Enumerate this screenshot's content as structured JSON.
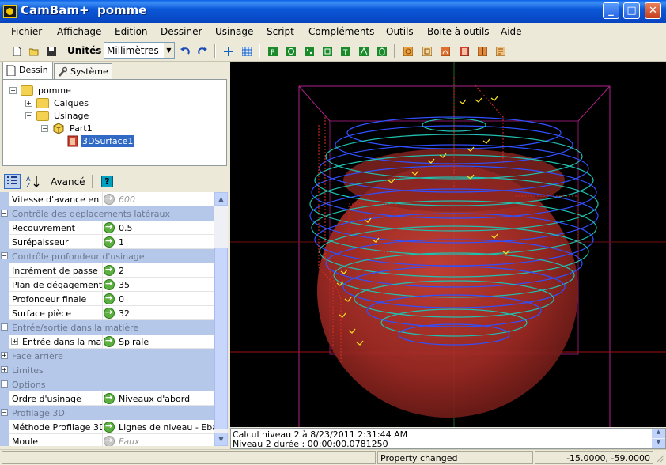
{
  "window": {
    "title": "CamBam+  pomme",
    "minimize_icon": "minimize-icon",
    "maximize_icon": "maximize-icon",
    "close_icon": "close-icon"
  },
  "menu": [
    "Fichier",
    "Affichage",
    "Edition",
    "Dessiner",
    "Usinage",
    "Script",
    "Compléments",
    "Outils",
    "Boite à outils",
    "Aide"
  ],
  "toolbar": {
    "units_label": "Unités",
    "units_value": "Millimètres"
  },
  "tabs": [
    {
      "label": "Dessin",
      "icon": "document-icon",
      "active": true
    },
    {
      "label": "Système",
      "icon": "wrench-icon",
      "active": false
    }
  ],
  "tree": {
    "root": "pomme",
    "calques": "Calques",
    "usinage": "Usinage",
    "part": "Part1",
    "op": "3DSurface1"
  },
  "props_toolbar": {
    "advanced_label": "Avancé"
  },
  "properties": {
    "r0": {
      "name": "Vitesse d'avance en plon",
      "value": "600"
    },
    "c1": "Contrôle des déplacements latéraux",
    "r2": {
      "name": "Recouvrement",
      "value": "0.5"
    },
    "r3": {
      "name": "Surépaisseur",
      "value": "1"
    },
    "c4": "Contrôle profondeur d'usinage",
    "r5": {
      "name": "Incrément de passe",
      "value": "2"
    },
    "r6": {
      "name": "Plan de dégagement",
      "value": "35"
    },
    "r7": {
      "name": "Profondeur finale",
      "value": "0"
    },
    "r8": {
      "name": "Surface pièce",
      "value": "32"
    },
    "c9": "Entrée/sortie dans la matière",
    "r10": {
      "name": "Entrée dans la matière",
      "value": "Spirale"
    },
    "c11": "Face arrière",
    "c12": "Limites",
    "c13": "Options",
    "r14": {
      "name": "Ordre d'usinage",
      "value": "Niveaux d'abord"
    },
    "c15": "Profilage 3D",
    "r16": {
      "name": "Méthode Profilage 3D",
      "value": "Lignes de niveau - Ebauche"
    },
    "r17": {
      "name": "Moule",
      "value": "Faux"
    }
  },
  "log": {
    "line1": "Calcul niveau 2 à 8/23/2011 2:31:44 AM",
    "line2": "Niveau 2 durée : 00:00:00.0781250"
  },
  "status": {
    "message": "Property changed",
    "coords": "-15.0000, -59.0000"
  },
  "colors": {
    "titlebar": "#0054e3",
    "category": "#b6c8e9",
    "viewport_bg": "#000000",
    "toolpath_blue": "#3050ff",
    "toolpath_cyan": "#20c0b0",
    "model_red": "#c0302a",
    "stock_magenta": "#b0208a"
  }
}
